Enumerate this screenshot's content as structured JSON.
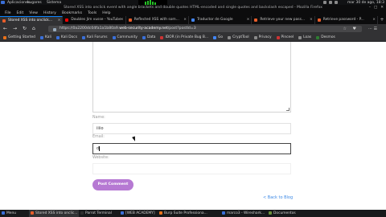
{
  "os_panel": {
    "applications": "Aplicaciones",
    "places": "Lugares",
    "system": "Sistema",
    "clock": "mar 30 de ago, 18:3",
    "monitor_levels": [
      0.6,
      0.9,
      1.0,
      0.7,
      0.5
    ]
  },
  "window": {
    "title": "Stored XSS into onclick event with angle brackets and double quotes HTML-encoded and single quotes and backslash escaped - Mozilla Firefox",
    "min": "–",
    "max": "□",
    "close": "✕"
  },
  "menu": [
    "File",
    "Edit",
    "View",
    "History",
    "Bookmarks",
    "Tools",
    "Help"
  ],
  "tabs": [
    {
      "label": "Stored XSS into onclick...",
      "color": "#e85d2a",
      "active": true
    },
    {
      "label": "Doubles Jim vusse - YouTube",
      "color": "#ff0000",
      "active": false
    },
    {
      "label": "Reflected XSS with som...",
      "color": "#e85d2a",
      "active": false
    },
    {
      "label": "Traductor de Google",
      "color": "#4285f4",
      "active": false
    },
    {
      "label": "Retrieve your new pass...",
      "color": "#e85d2a",
      "active": false
    },
    {
      "label": "Retrieve password - P...",
      "color": "#e85d2a",
      "active": false
    }
  ],
  "nav": {
    "back": "←",
    "forward": "→",
    "reload": "↻",
    "home": "⌂",
    "url_path": "https://0a2200dc04fa1a1b80a9.",
    "url_host": "web-security-academy.net",
    "url_rest": "/post?postId=3",
    "url_right_icons": "☆ ♥",
    "extensions": "⋯ ☰"
  },
  "bookmarks": [
    {
      "label": "Getting Started",
      "color": "#e8711a"
    },
    {
      "label": "Kali",
      "color": "#3a6fd8"
    },
    {
      "label": "Kali Docs",
      "color": "#3a6fd8"
    },
    {
      "label": "Kali Forums",
      "color": "#3a6fd8"
    },
    {
      "label": "Community",
      "color": "#3a6fd8"
    },
    {
      "label": "Data",
      "color": "#3a6fd8"
    },
    {
      "label": "IDOR (in Private Bug B...",
      "color": "#cc3333"
    },
    {
      "label": "Go",
      "color": "#4285f4"
    },
    {
      "label": "CryptTool",
      "color": "#8a8a8a"
    },
    {
      "label": "Privacy",
      "color": "#8a8a8a"
    },
    {
      "label": "Pinceel",
      "color": "#cc3333"
    },
    {
      "label": "Loas",
      "color": "#8a8a8a"
    },
    {
      "label": "Desmos",
      "color": "#2e7d32"
    }
  ],
  "form": {
    "name_label": "Name:",
    "name_value": "iiiio",
    "email_label": "Email:",
    "email_value": "d",
    "website_label": "Website:",
    "website_value": "",
    "submit_label": "Post Comment",
    "back_link": "< Back to Blog"
  },
  "taskbar": [
    {
      "label": "Menu",
      "color": "#3a6fd8",
      "active": false
    },
    {
      "label": "Stored XSS into onclic...",
      "color": "#e85d2a",
      "active": true
    },
    {
      "label": "Parrot Terminal",
      "color": "#2e2e2e",
      "active": false
    },
    {
      "label": "[WEB ACADEMY]",
      "color": "#3a6fd8",
      "active": false
    },
    {
      "label": "Burp Suite Professiona...",
      "color": "#e8711a",
      "active": false
    },
    {
      "label": "marco3 - Wireshark...",
      "color": "#3a6fd8",
      "active": false
    },
    {
      "label": "Documentos",
      "color": "#6a8f3a",
      "active": false
    }
  ]
}
